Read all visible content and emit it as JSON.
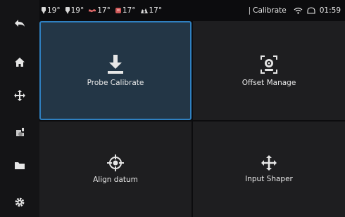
{
  "status": {
    "temps": [
      {
        "icon": "nozzle-temp-icon",
        "value": "19°",
        "color": "#d8d8d8"
      },
      {
        "icon": "nozzle-temp-icon",
        "value": "19°",
        "color": "#d8d8d8"
      },
      {
        "icon": "heated-bed-icon",
        "value": "17°",
        "color": "#e06a6a"
      },
      {
        "icon": "chamber-icon",
        "value": "17°",
        "color": "#d05a5a"
      },
      {
        "icon": "fan-icon",
        "value": "17°",
        "color": "#d8d8d8"
      }
    ],
    "separator": "|",
    "page_name": "Calibrate",
    "time": "01:59"
  },
  "sidebar": {
    "items": [
      {
        "icon": "back-arrow-icon"
      },
      {
        "icon": "home-icon"
      },
      {
        "icon": "move-icon"
      },
      {
        "icon": "extruder-icon"
      },
      {
        "icon": "folder-icon"
      },
      {
        "icon": "gear-icon"
      }
    ]
  },
  "tiles": [
    {
      "label": "Probe Calibrate",
      "icon": "download-arrow-icon",
      "selected": true
    },
    {
      "label": "Offset Manage",
      "icon": "camera-target-icon",
      "selected": false
    },
    {
      "label": "Align datum",
      "icon": "crosshair-icon",
      "selected": false
    },
    {
      "label": "Input Shaper",
      "icon": "move-arrows-icon",
      "selected": false
    }
  ],
  "colors": {
    "accent": "#2f80c0",
    "tile_bg": "#1e1e20",
    "tile_selected_bg": "#233646",
    "background": "#0c0c0e"
  }
}
